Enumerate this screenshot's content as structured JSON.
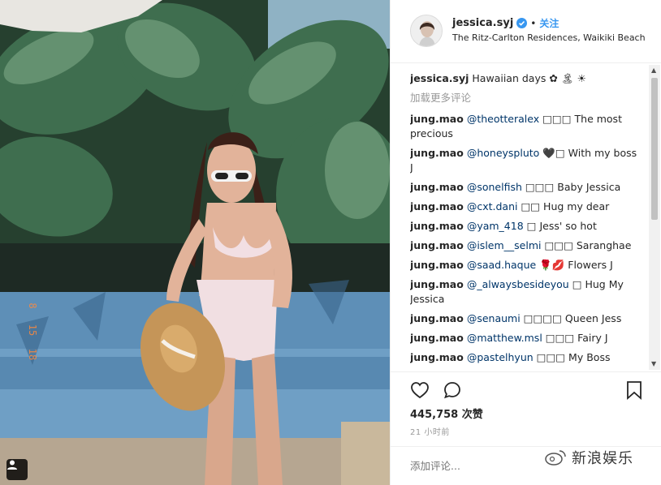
{
  "post": {
    "username": "jessica.syj",
    "follow_label": "关注",
    "dot": "•",
    "location": "The Ritz-Carlton Residences, Waikiki Beach",
    "photo_date": [
      "8",
      "15",
      "18"
    ]
  },
  "caption": {
    "author": "jessica.syj",
    "text": "Hawaiian days ✿ 🏝 ☀"
  },
  "load_more_label": "加载更多评论",
  "comments": [
    {
      "author": "jung.mao",
      "mention": "@theotteralex",
      "text": "□□□ The most precious"
    },
    {
      "author": "jung.mao",
      "mention": "@honeyspluto",
      "text": "🖤□ With my boss J"
    },
    {
      "author": "jung.mao",
      "mention": "@sonelfish",
      "text": "□□□ Baby Jessica"
    },
    {
      "author": "jung.mao",
      "mention": "@cxt.dani",
      "text": "□□ Hug my dear"
    },
    {
      "author": "jung.mao",
      "mention": "@yam_418",
      "text": "□ Jess' so hot"
    },
    {
      "author": "jung.mao",
      "mention": "@islem__selmi",
      "text": "□□□ Saranghae"
    },
    {
      "author": "jung.mao",
      "mention": "@saad.haque",
      "text": "🌹💋 Flowers J"
    },
    {
      "author": "jung.mao",
      "mention": "@_alwaysbesideyou",
      "text": "□ Hug My Jessica"
    },
    {
      "author": "jung.mao",
      "mention": "@senaumi",
      "text": "□□□□ Queen Jess"
    },
    {
      "author": "jung.mao",
      "mention": "@matthew.msl",
      "text": "□□□ Fairy J"
    },
    {
      "author": "jung.mao",
      "mention": "@pastelhyun",
      "text": "□□□ My Boss"
    }
  ],
  "likes": "445,758 次赞",
  "time": "21 小时前",
  "add_comment_placeholder": "添加评论...",
  "watermark": "新浪娱乐",
  "icons": {
    "like": "heart-icon",
    "comment": "comment-bubble-icon",
    "save": "bookmark-icon",
    "verified": "verified-badge-icon",
    "user_tag": "user-tag-icon"
  },
  "colors": {
    "accent": "#3897f0",
    "mention": "#003569",
    "muted": "#999999"
  }
}
